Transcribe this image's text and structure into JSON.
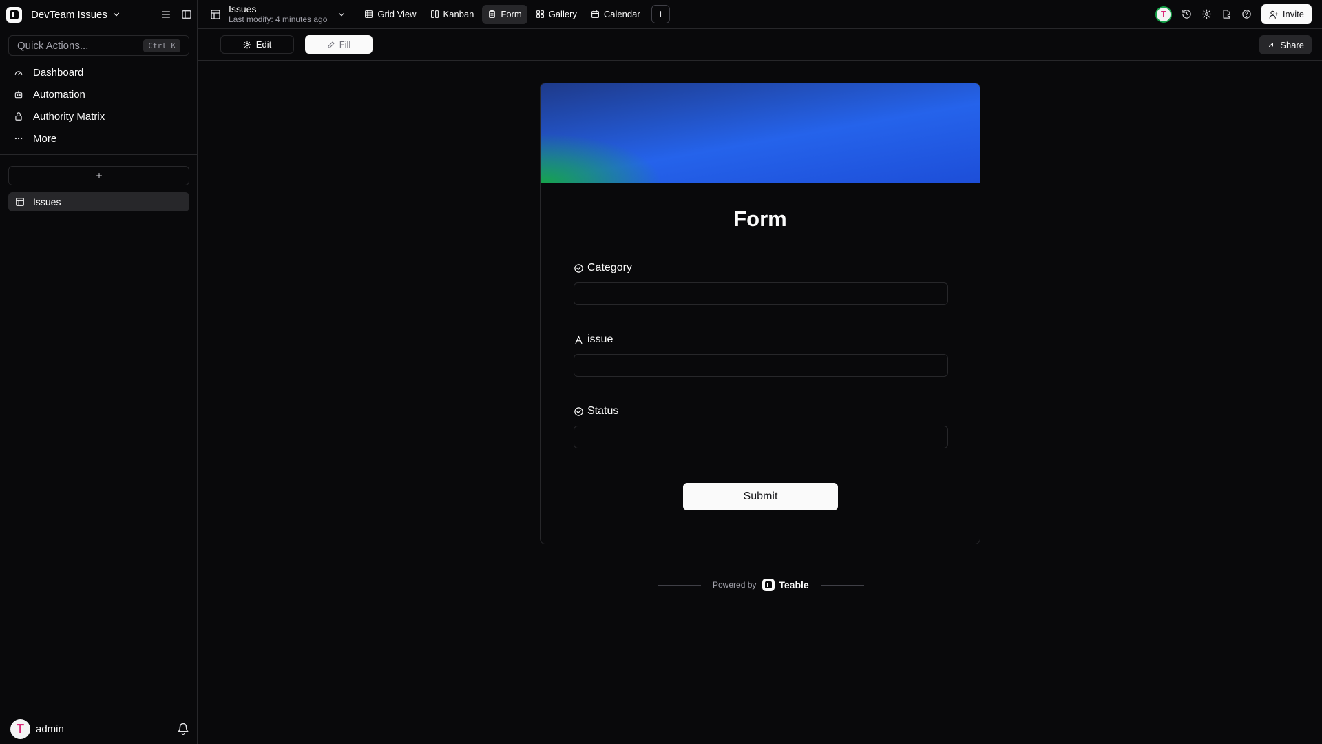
{
  "space": {
    "name": "DevTeam Issues"
  },
  "sidebar": {
    "quick_actions": {
      "placeholder": "Quick Actions...",
      "shortcut": "Ctrl K"
    },
    "nav": [
      {
        "label": "Dashboard",
        "icon": "gauge-icon"
      },
      {
        "label": "Automation",
        "icon": "robot-icon"
      },
      {
        "label": "Authority Matrix",
        "icon": "lock-icon"
      },
      {
        "label": "More",
        "icon": "ellipsis-icon"
      }
    ],
    "tables": [
      {
        "label": "Issues",
        "icon": "table-icon"
      }
    ],
    "user": {
      "name": "admin",
      "avatar_letter": "T"
    }
  },
  "topbar": {
    "table_name": "Issues",
    "last_modified": "Last modify: 4 minutes ago",
    "views": [
      {
        "label": "Grid View",
        "icon": "grid-icon",
        "active": false
      },
      {
        "label": "Kanban",
        "icon": "kanban-icon",
        "active": false
      },
      {
        "label": "Form",
        "icon": "form-icon",
        "active": true
      },
      {
        "label": "Gallery",
        "icon": "gallery-icon",
        "active": false
      },
      {
        "label": "Calendar",
        "icon": "calendar-icon",
        "active": false
      }
    ],
    "collaborator_letter": "T",
    "invite_label": "Invite"
  },
  "subbar": {
    "edit_label": "Edit",
    "fill_label": "Fill",
    "share_label": "Share"
  },
  "form": {
    "title": "Form",
    "fields": [
      {
        "label": "Category",
        "icon": "select-icon",
        "value": ""
      },
      {
        "label": "issue",
        "icon": "text-icon",
        "value": ""
      },
      {
        "label": "Status",
        "icon": "select-icon",
        "value": ""
      }
    ],
    "submit_label": "Submit"
  },
  "footer": {
    "powered_by": "Powered by",
    "brand": "Teable"
  },
  "colors": {
    "background": "#09090b",
    "border": "#27272a",
    "banner_blue": "#2563eb",
    "banner_green": "#16a34a",
    "avatar_accent": "#db2777"
  }
}
